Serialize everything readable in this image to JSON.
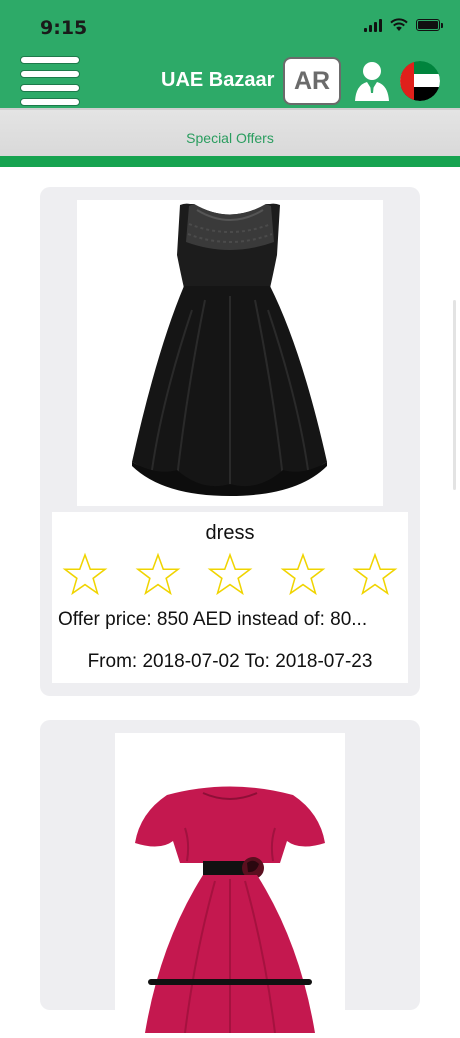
{
  "status_bar": {
    "time": "9:15"
  },
  "header": {
    "title": "UAE Bazaar",
    "language_button": "AR",
    "icons": [
      "menu-icon",
      "user-icon",
      "uae-flag-icon"
    ]
  },
  "subheader": {
    "label": "Special Offers"
  },
  "colors": {
    "primary_green": "#2daa68",
    "accent_green": "#17a350",
    "card_bg": "#eeeef1",
    "star": "#f0d400"
  },
  "offers": [
    {
      "name": "dress",
      "rating": 0,
      "rating_max": 5,
      "price_text": "Offer price: 850 AED instead of: 80...",
      "date_text": "From: 2018-07-02 To: 2018-07-23",
      "image": "black sleeveless lace dress"
    },
    {
      "image": "pink ruffle dress with flower belt"
    }
  ]
}
